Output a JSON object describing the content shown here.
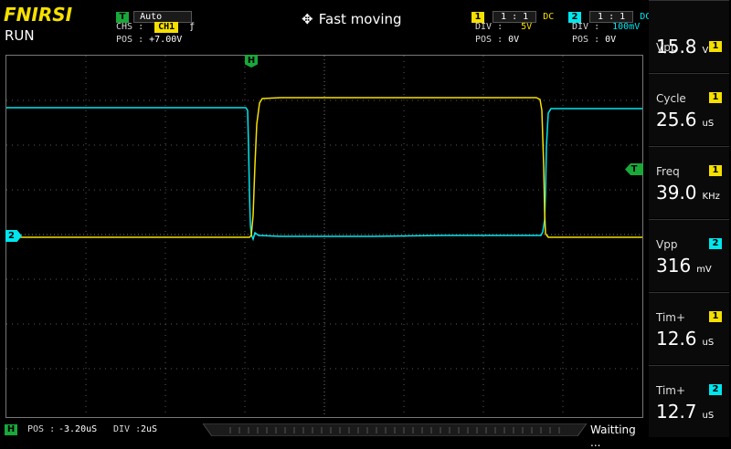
{
  "header": {
    "brand": "FNIRSI",
    "run_state": "RUN",
    "mode_center": "Fast moving",
    "trigger": {
      "badge": "T",
      "mode": "Auto",
      "source_label": "CHS :",
      "source": "CH1",
      "edge_symbol": "ƒ",
      "pos_label": "POS :",
      "pos_value": "+7.00V"
    },
    "ch1": {
      "badge": "1",
      "probe": "1 : 1",
      "coupling": "DC",
      "div_label": "DIV :",
      "div_value": "5V",
      "pos_label": "POS :",
      "pos_value": "0V"
    },
    "ch2": {
      "badge": "2",
      "probe": "1 : 1",
      "coupling": "DC",
      "div_label": "DIV :",
      "div_value": "100mV",
      "pos_label": "POS :",
      "pos_value": "0V"
    }
  },
  "markers": {
    "h_marker": "H",
    "trigger_marker": "T",
    "ch2_marker": "2"
  },
  "measurements": [
    {
      "label": "Vpp",
      "channel": "1",
      "value": "15.8",
      "unit": "V"
    },
    {
      "label": "Cycle",
      "channel": "1",
      "value": "25.6",
      "unit": "uS"
    },
    {
      "label": "Freq",
      "channel": "1",
      "value": "39.0",
      "unit": "KHz"
    },
    {
      "label": "Vpp",
      "channel": "2",
      "value": "316",
      "unit": "mV"
    },
    {
      "label": "Tim+",
      "channel": "1",
      "value": "12.6",
      "unit": "uS"
    },
    {
      "label": "Tim+",
      "channel": "2",
      "value": "12.7",
      "unit": "uS"
    }
  ],
  "footer": {
    "h_badge": "H",
    "pos_label": "POS :",
    "pos_value": "-3.20uS",
    "div_label": "DIV :",
    "div_value": "2uS",
    "status": "Waitting ..."
  },
  "colors": {
    "ch1": "#f5e000",
    "ch2": "#00e6ef",
    "trigger": "#19a83a"
  }
}
